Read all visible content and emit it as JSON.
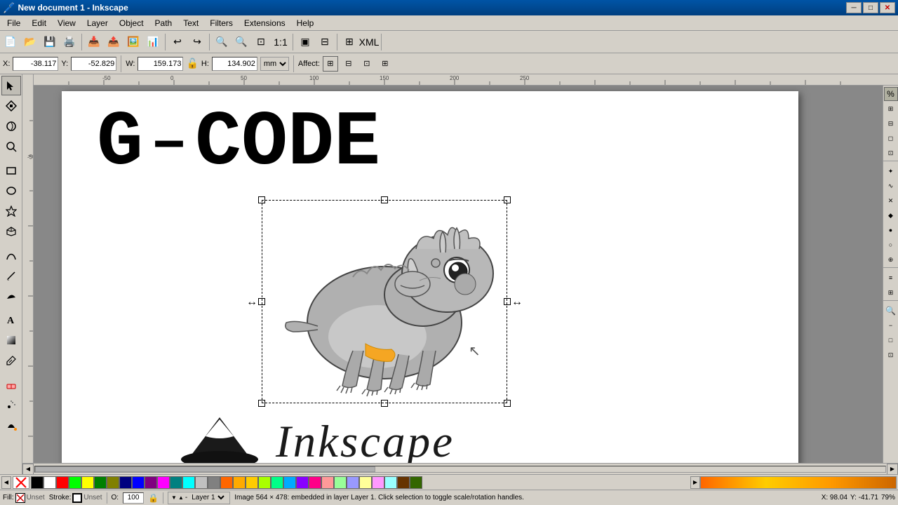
{
  "window": {
    "title": "New document 1 - Inkscape",
    "minimize": "─",
    "maximize": "□",
    "close": "✕"
  },
  "menu": {
    "items": [
      "File",
      "Edit",
      "View",
      "Layer",
      "Object",
      "Path",
      "Text",
      "Filters",
      "Extensions",
      "Help"
    ]
  },
  "toolbar1": {
    "buttons": [
      "📄",
      "📂",
      "💾",
      "🖨️",
      "📋",
      "✂️",
      "📋",
      "↩",
      "↪",
      "🔍",
      "🔍"
    ]
  },
  "toolbar2": {
    "x_label": "X:",
    "x_value": "-38.117",
    "y_label": "Y:",
    "y_value": "-52.829",
    "w_label": "W:",
    "w_value": "159.173",
    "h_label": "H:",
    "h_value": "134.902",
    "unit": "mm",
    "affect_label": "Affect:"
  },
  "tools": [
    "↖",
    "✏️",
    "☐",
    "○",
    "⭐",
    "🌀",
    "✒️",
    "✏️",
    "🔤",
    "🎨",
    "🖊️",
    "🖌️",
    "📐",
    "✂️",
    "💧",
    "🌊"
  ],
  "gcode": {
    "text": "G – C O D E"
  },
  "status": {
    "fill_label": "Fill:",
    "fill_value": "Unset",
    "stroke_label": "Stroke:",
    "stroke_value": "Unset",
    "opacity_label": "O:",
    "opacity_value": "100",
    "layer": "Layer 1",
    "message": "Image 564 × 478: embedded in layer Layer 1. Click selection to toggle scale/rotation handles.",
    "x_coord": "X: 98.04",
    "y_coord": "Y: -41.71",
    "zoom": "79%"
  },
  "palette": {
    "none_symbol": "✕",
    "colors": [
      "#000000",
      "#ffffff",
      "#ff0000",
      "#00ff00",
      "#0000ff",
      "#ffff00",
      "#ff00ff",
      "#00ffff",
      "#800000",
      "#008000",
      "#000080",
      "#808000",
      "#800080",
      "#008080",
      "#c0c0c0",
      "#808080",
      "#ff6600",
      "#ffaa00",
      "#ffcc00",
      "#aaff00",
      "#00ff88",
      "#00aaff",
      "#8800ff",
      "#ff0088",
      "#ff9999",
      "#99ff99",
      "#9999ff",
      "#ffff99",
      "#ff99ff",
      "#99ffff",
      "#663300",
      "#336600"
    ]
  },
  "snap_buttons": [
    "⊞",
    "⊡",
    "⋈",
    "✛",
    "○",
    "◇",
    "△",
    "⊕",
    "⊗",
    "☰",
    "∥",
    "⊥",
    "⌖",
    "⋯",
    "⋮",
    "⊠"
  ],
  "right_panel_buttons": [
    "↕",
    "↔",
    "⟷",
    "⟺",
    "↩",
    "↕",
    "↗",
    "↙",
    "🔍",
    "🔍",
    "🔍",
    "🔍",
    "🔍",
    "🔍",
    "🔍",
    "🔍"
  ]
}
